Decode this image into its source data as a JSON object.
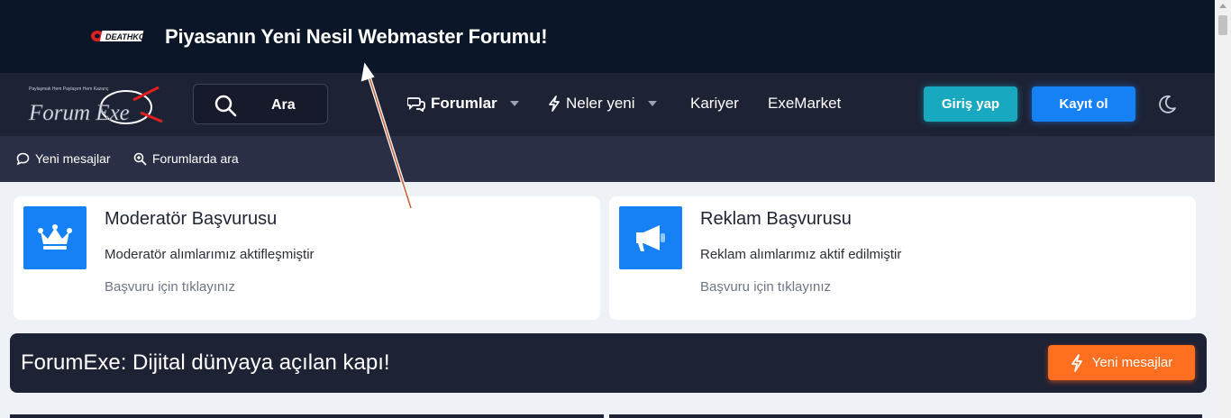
{
  "banner": {
    "logo_text": "DEATHKO",
    "title": "Piyasanın Yeni Nesil Webmaster Forumu!"
  },
  "nav": {
    "brand_text": "Forum Exe",
    "brand_tagline": "Paylaşmak Hem Paylaşım Hem Kazanç",
    "search_label": "Ara",
    "items": [
      {
        "label": "Forumlar",
        "icon": "chat-bubbles-icon",
        "has_dropdown": true
      },
      {
        "label": "Neler yeni",
        "icon": "lightning-icon",
        "has_dropdown": true
      },
      {
        "label": "Kariyer"
      },
      {
        "label": "ExeMarket"
      }
    ],
    "login_label": "Giriş yap",
    "register_label": "Kayıt ol",
    "theme_icon": "moon-icon"
  },
  "subnav": {
    "items": [
      {
        "label": "Yeni mesajlar",
        "icon": "chat-bubble-icon"
      },
      {
        "label": "Forumlarda ara",
        "icon": "search-zoom-icon"
      }
    ]
  },
  "cards": [
    {
      "title": "Moderatör Başvurusu",
      "description": "Moderatör alımlarımız aktifleşmiştir",
      "link": "Başvuru için tıklayınız",
      "icon": "crown-icon"
    },
    {
      "title": "Reklam Başvurusu",
      "description": "Reklam alımlarımız aktif edilmiştir",
      "link": "Başvuru için tıklayınız",
      "icon": "megaphone-icon"
    }
  ],
  "hero": {
    "text": "ForumExe: Dijital dünyaya açılan kapı!",
    "button_label": "Yeni mesajlar",
    "button_icon": "lightning-icon"
  },
  "colors": {
    "banner_bg": "#0b1729",
    "nav_bg": "#1d2235",
    "subnav_bg": "#2a2f45",
    "login_btn": "#18a9c0",
    "register_btn": "#1681f5",
    "accent_orange": "#ff6f1f",
    "page_bg": "#eef1f6"
  }
}
